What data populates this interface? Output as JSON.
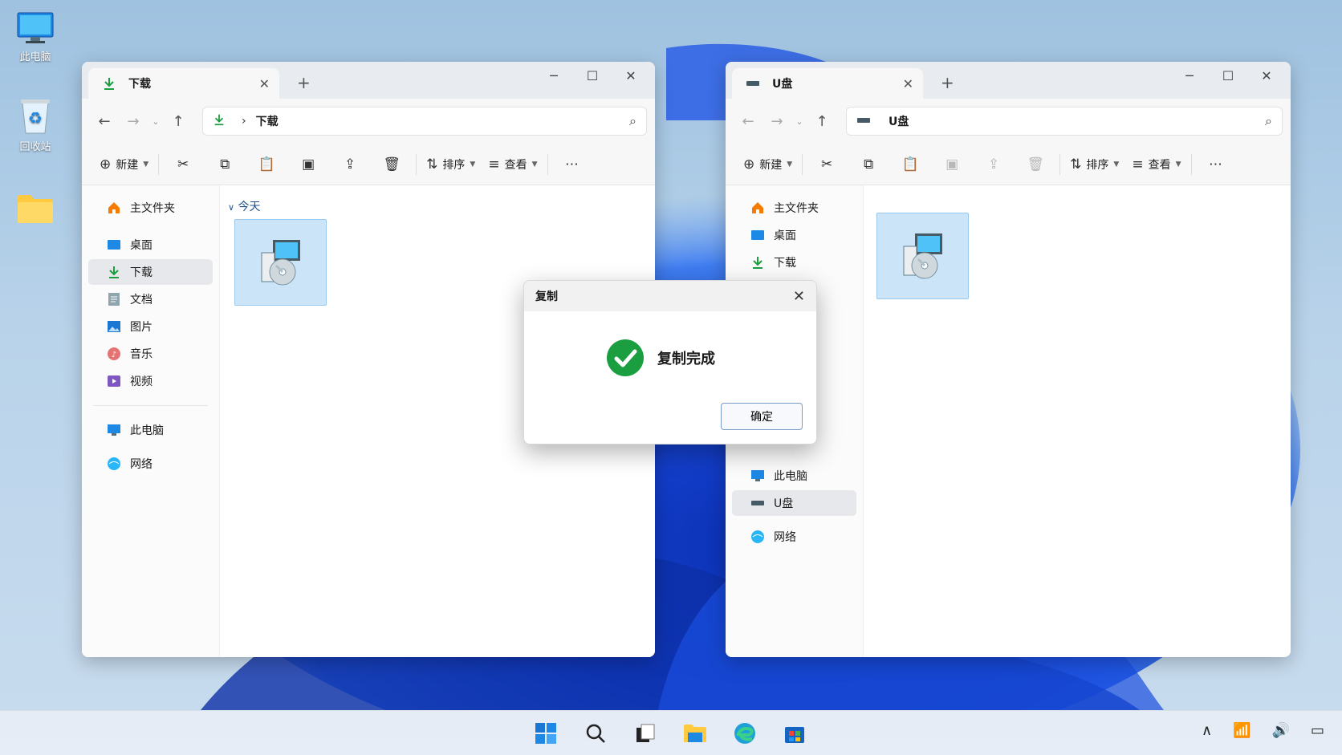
{
  "desktop": {
    "icons": [
      {
        "label": "此电脑",
        "icon": "computer-icon"
      },
      {
        "label": "回收站",
        "icon": "recycle-bin-icon"
      },
      {
        "label": "",
        "icon": "folder-icon"
      }
    ]
  },
  "left_window": {
    "tab_title": "下载",
    "address": "下载",
    "toolbar": {
      "new_label": "新建",
      "sort_label": "排序",
      "view_label": "查看"
    },
    "sidebar": [
      {
        "label": "主文件夹",
        "icon": "home-icon"
      },
      {
        "label": "桌面",
        "icon": "desktop-icon"
      },
      {
        "label": "下载",
        "icon": "download-icon",
        "selected": true
      },
      {
        "label": "文档",
        "icon": "document-icon"
      },
      {
        "label": "图片",
        "icon": "pictures-icon"
      },
      {
        "label": "音乐",
        "icon": "music-icon"
      },
      {
        "label": "视频",
        "icon": "video-icon"
      },
      {
        "label": "此电脑",
        "icon": "computer-icon"
      },
      {
        "label": "网络",
        "icon": "network-icon"
      }
    ],
    "group_label": "今天"
  },
  "right_window": {
    "tab_title": "U盘",
    "address": "U盘",
    "toolbar": {
      "new_label": "新建",
      "sort_label": "排序",
      "view_label": "查看"
    },
    "sidebar": [
      {
        "label": "主文件夹",
        "icon": "home-icon"
      },
      {
        "label": "桌面",
        "icon": "desktop-icon"
      },
      {
        "label": "下载",
        "icon": "download-icon"
      },
      {
        "label": "此电脑",
        "icon": "computer-icon"
      },
      {
        "label": "U盘",
        "icon": "usb-drive-icon",
        "selected": true
      },
      {
        "label": "网络",
        "icon": "network-icon"
      }
    ]
  },
  "dialog": {
    "title": "复制",
    "message": "复制完成",
    "ok_label": "确定"
  },
  "colors": {
    "accent": "#0067c0",
    "success": "#1a9e3f",
    "selection": "#cce4f7"
  }
}
